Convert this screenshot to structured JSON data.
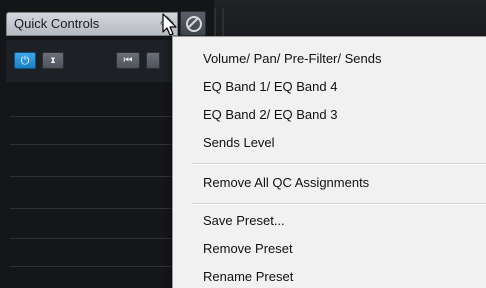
{
  "header": {
    "title": "Quick Controls"
  },
  "toolbar": {
    "power_icon": "⏻",
    "learn_icon": "ɪ",
    "prev_icon": "⏮"
  },
  "menu": {
    "items": [
      "Volume/ Pan/ Pre-Filter/ Sends",
      "EQ Band 1/ EQ Band 4",
      "EQ Band 2/ EQ Band 3",
      "Sends Level",
      "Remove All QC Assignments",
      "Save Preset...",
      "Remove Preset",
      "Rename Preset"
    ]
  },
  "colors": {
    "accent_blue": "#1d7fc3",
    "menu_background": "#f1f1f1",
    "panel_background": "#14161a"
  },
  "icons": [
    "diamond-icon",
    "mouse-cursor-icon",
    "disable-icon",
    "power-icon",
    "learn-icon",
    "previous-icon",
    "next-icon"
  ]
}
